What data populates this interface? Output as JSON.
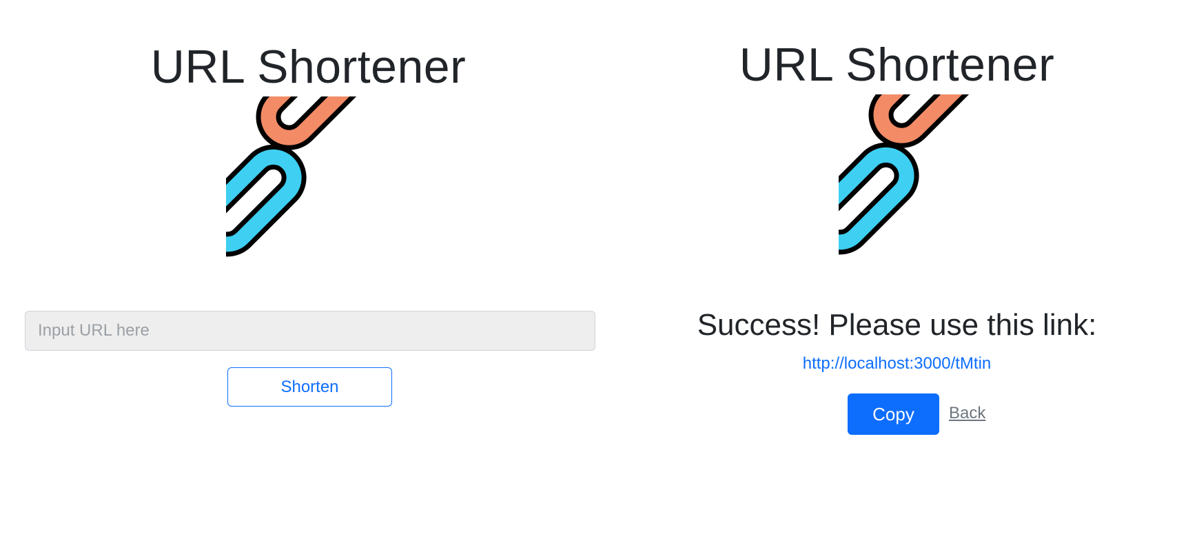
{
  "left": {
    "title": "URL Shortener",
    "input": {
      "placeholder": "Input URL here",
      "value": ""
    },
    "shorten_label": "Shorten"
  },
  "right": {
    "title": "URL Shortener",
    "success_message": "Success! Please use this link:",
    "short_link": "http://localhost:3000/tMtin",
    "copy_label": "Copy",
    "back_label": "Back"
  },
  "icons": {
    "logo": "chain-link-icon"
  },
  "colors": {
    "primary": "#0d6efd",
    "text": "#212529",
    "muted": "#6c757d",
    "input_bg": "#eeeeee",
    "link_orange": "#f28b66",
    "link_blue": "#3ecff2",
    "outline": "#000000"
  }
}
